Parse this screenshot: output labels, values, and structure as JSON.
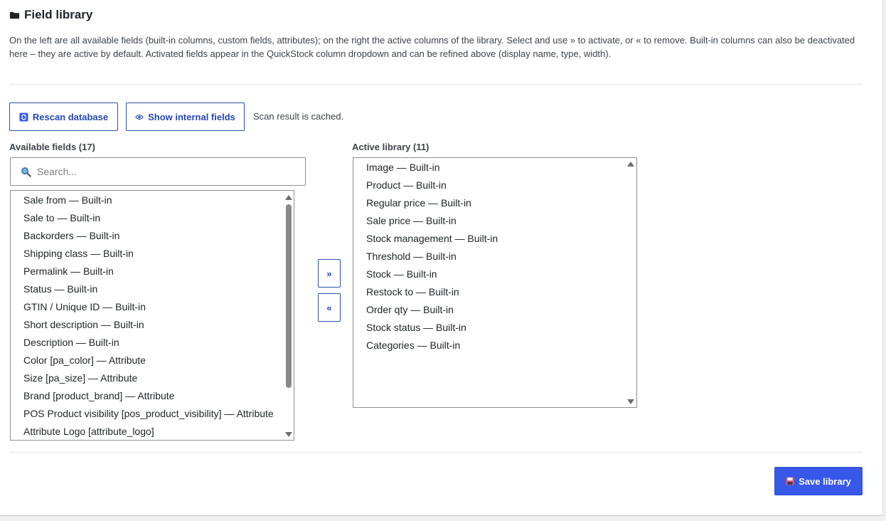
{
  "header": {
    "title": "Field library",
    "icon": "folder-icon"
  },
  "description": "On the left are all available fields (built-in columns, custom fields, attributes); on the right the active columns of the library. Select and use » to activate, or « to remove. Built-in columns can also be deactivated here – they are active by default. Activated fields appear in the QuickStock column dropdown and can be refined above (display name, type, width).",
  "toolbar": {
    "rescan_label": "Rescan database",
    "show_internal_label": "Show internal fields",
    "scan_note": "Scan result is cached."
  },
  "available": {
    "label": "Available fields (17)",
    "search_placeholder": "Search...",
    "items": [
      "Sale from — Built-in",
      "Sale to — Built-in",
      "Backorders — Built-in",
      "Shipping class — Built-in",
      "Permalink — Built-in",
      "Status — Built-in",
      "GTIN / Unique ID — Built-in",
      "Short description — Built-in",
      "Description — Built-in",
      "Color [pa_color] — Attribute",
      "Size [pa_size] — Attribute",
      "Brand [product_brand] — Attribute",
      "POS Product visibility [pos_product_visibility] — Attribute",
      "Attribute Logo [attribute_logo]"
    ]
  },
  "move": {
    "activate_label": "»",
    "remove_label": "«"
  },
  "active": {
    "label": "Active library (11)",
    "items": [
      "Image — Built-in",
      "Product — Built-in",
      "Regular price — Built-in",
      "Sale price — Built-in",
      "Stock management — Built-in",
      "Threshold — Built-in",
      "Stock — Built-in",
      "Restock to — Built-in",
      "Order qty — Built-in",
      "Stock status — Built-in",
      "Categories — Built-in"
    ]
  },
  "footer": {
    "save_label": "Save library"
  },
  "colors": {
    "accent": "#3858e9",
    "link": "#2447b4"
  }
}
